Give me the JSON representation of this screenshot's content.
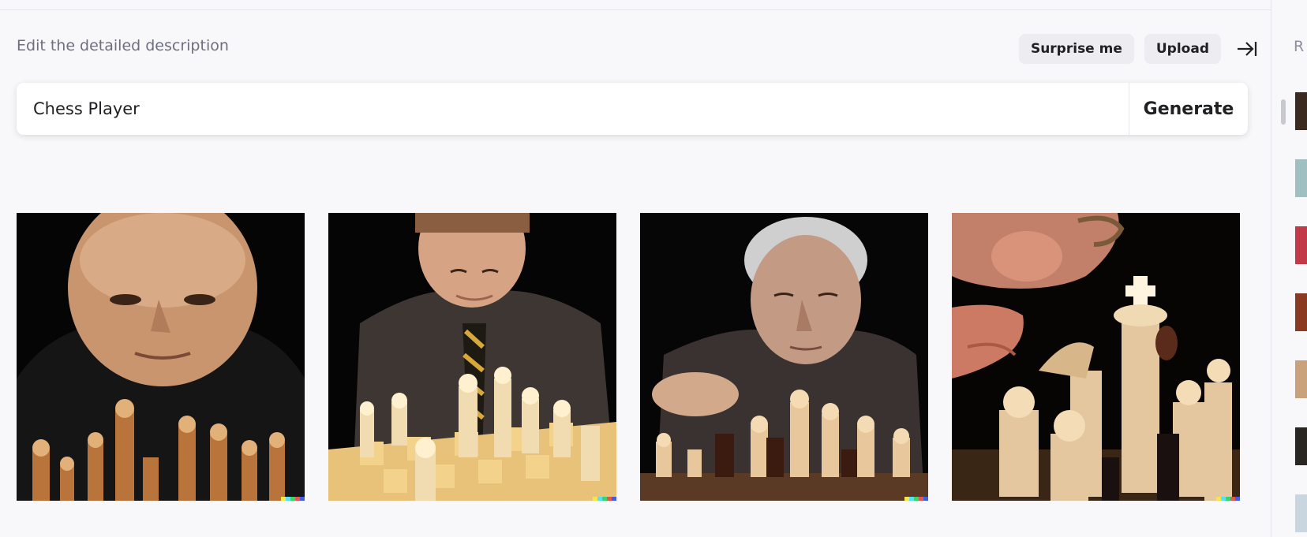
{
  "editor": {
    "heading": "Edit the detailed description",
    "surprise_label": "Surprise me",
    "upload_label": "Upload",
    "collapse_icon": "collapse-right-icon",
    "prompt_value": "Chess Player",
    "generate_label": "Generate"
  },
  "results": [
    {
      "name": "result-image-1",
      "subject": "bald man in dark shirt behind wooden chess pieces"
    },
    {
      "name": "result-image-2",
      "subject": "young man in shirt and striped tie over a yellow chessboard"
    },
    {
      "name": "result-image-3",
      "subject": "grey-haired man moving a chess piece"
    },
    {
      "name": "result-image-4",
      "subject": "close-up of player's face and hand over large white chess pieces"
    }
  ],
  "sidebar": {
    "header_letter": "R",
    "thumb_colors": [
      "#3b2a20",
      "#9fbfc0",
      "#c23a4a",
      "#8a3a20",
      "#c9a27c",
      "#2a2622",
      "#c9d6e0"
    ]
  },
  "signature_colors": [
    "#f5e54a",
    "#5ae0f5",
    "#39d46a",
    "#e0584f",
    "#3f5fe0"
  ]
}
